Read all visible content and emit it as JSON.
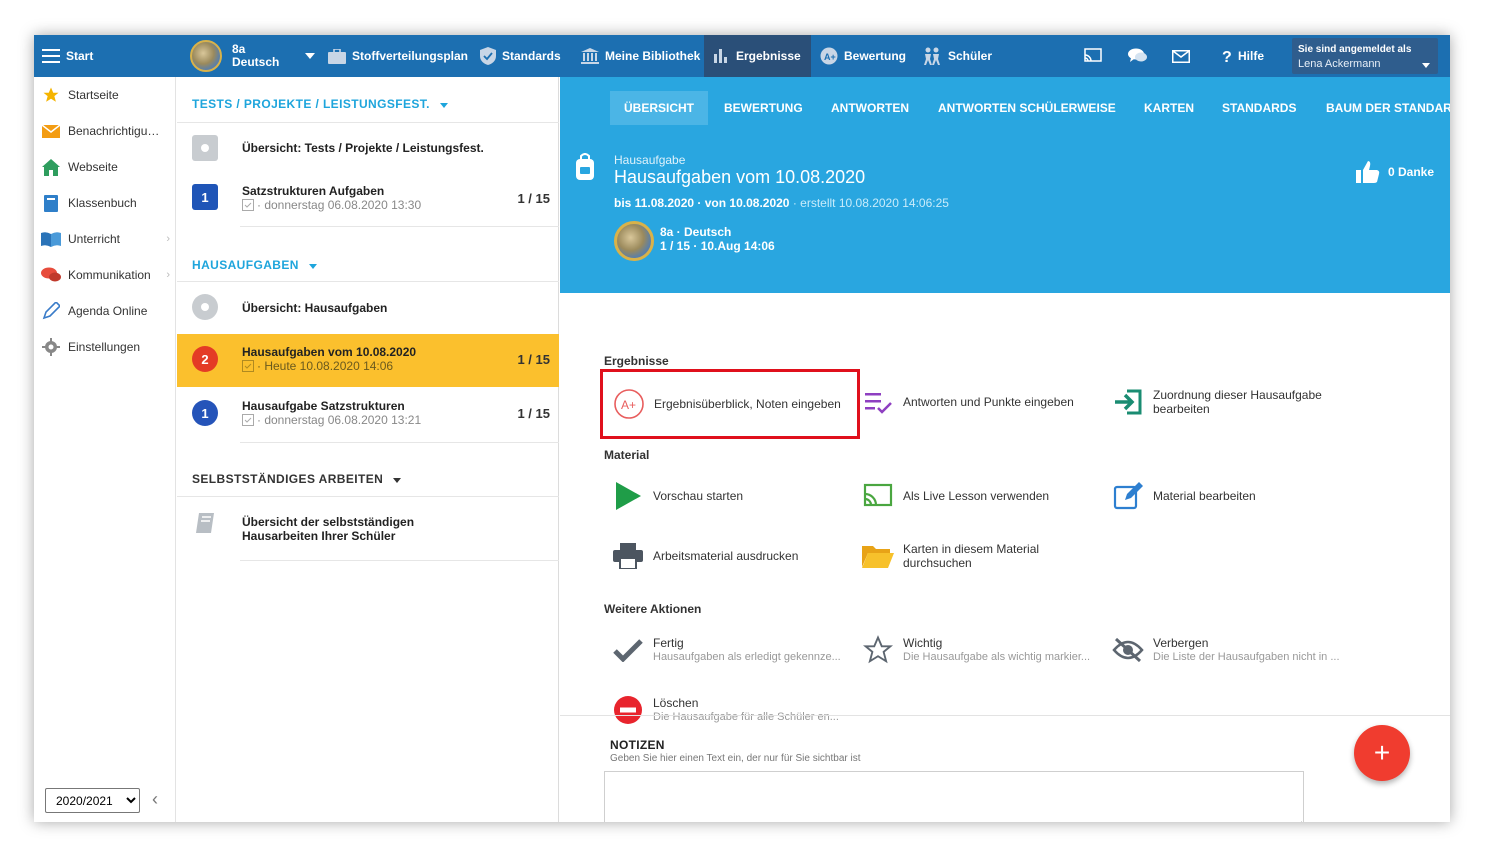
{
  "topbar": {
    "menu_label": "Start",
    "class_name": "8a",
    "class_subject": "Deutsch",
    "nav": [
      "Stoffverteilungsplan",
      "Standards",
      "Meine Bibliothek",
      "Ergebnisse",
      "Bewertung",
      "Schüler"
    ],
    "help_label": "Hilfe",
    "login_label": "Sie sind angemeldet als",
    "user_name": "Lena Ackermann"
  },
  "sidebar": {
    "items": [
      "Startseite",
      "Benachrichtigungen",
      "Webseite",
      "Klassenbuch",
      "Unterricht",
      "Kommunikation",
      "Agenda Online",
      "Einstellungen"
    ],
    "year": "2020/2021"
  },
  "middle": {
    "tests_header": "TESTS / PROJEKTE / LEISTUNGSFEST.",
    "tests_overview": "Übersicht: Tests / Projekte / Leistungsfest.",
    "test1": {
      "badge": "1",
      "title": "Satzstrukturen Aufgaben",
      "sub": "· donnerstag 06.08.2020 13:30",
      "count": "1 / 15"
    },
    "homework_header": "HAUSAUFGABEN",
    "homework_overview": "Übersicht: Hausaufgaben",
    "hw1": {
      "badge": "2",
      "title": "Hausaufgaben vom 10.08.2020",
      "sub": "· Heute 10.08.2020 14:06",
      "count": "1 / 15"
    },
    "hw2": {
      "badge": "1",
      "title": "Hausaufgabe Satzstrukturen",
      "sub": "· donnerstag 06.08.2020 13:21",
      "count": "1 / 15"
    },
    "self_header": "SELBSTSTÄNDIGES ARBEITEN",
    "self_line1": "Übersicht der selbstständigen",
    "self_line2": "Hausarbeiten Ihrer Schüler"
  },
  "tabs": [
    "ÜBERSICHT",
    "BEWERTUNG",
    "ANTWORTEN",
    "ANTWORTEN SCHÜLERWEISE",
    "KARTEN",
    "STANDARDS",
    "BAUM DER STANDARDS"
  ],
  "hero": {
    "kind": "Hausaufgabe",
    "title": "Hausaufgaben vom 10.08.2020",
    "due": "bis 11.08.2020",
    "from": "· von 10.08.2020",
    "created": "· erstellt 10.08.2020 14:06:25",
    "class": "8a · Deutsch",
    "meta": "1 / 15 · 10.Aug 14:06",
    "thanks": "0 Danke"
  },
  "groups": {
    "results": "Ergebnisse",
    "material": "Material",
    "more": "Weitere Aktionen"
  },
  "actions": {
    "results_overview": "Ergebnisüberblick, Noten eingeben",
    "answers_points": "Antworten und Punkte eingeben",
    "assign_1": "Zuordnung dieser Hausaufgabe",
    "assign_2": "bearbeiten",
    "preview": "Vorschau starten",
    "live_lesson": "Als Live Lesson verwenden",
    "edit_material": "Material bearbeiten",
    "print": "Arbeitsmaterial ausdrucken",
    "search_cards_1": "Karten in diesem Material",
    "search_cards_2": "durchsuchen",
    "done": "Fertig",
    "done_sub": "Hausaufgaben als erledigt gekennze...",
    "important": "Wichtig",
    "important_sub": "Die Hausaufgabe als wichtig markier...",
    "hide": "Verbergen",
    "hide_sub": "Die Liste der Hausaufgaben nicht in ...",
    "delete": "Löschen",
    "delete_sub": "Die Hausaufgabe für alle Schüler en..."
  },
  "notes": {
    "title": "NOTIZEN",
    "hint": "Geben Sie hier einen Text ein, der nur für Sie sichtbar ist"
  },
  "fab_label": "+",
  "colors": {
    "topbar": "#1c6fb1",
    "accent": "#29a6e0",
    "active_row": "#fbc02d",
    "highlight": "#e0101c",
    "fab": "#f03c2f"
  }
}
